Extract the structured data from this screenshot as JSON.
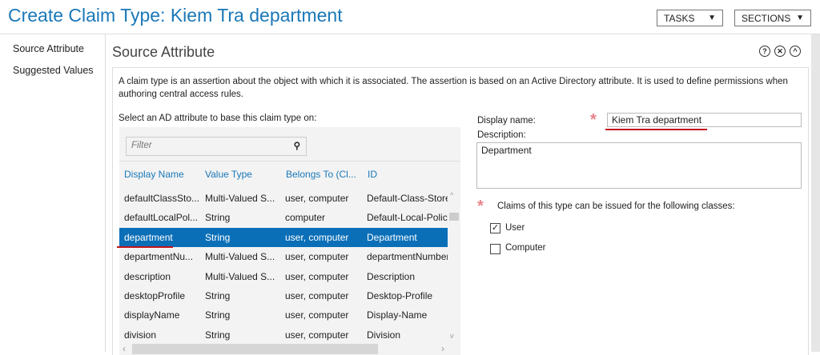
{
  "header": {
    "title": "Create Claim Type: Kiem Tra department",
    "tasks_label": "TASKS",
    "sections_label": "SECTIONS"
  },
  "nav": {
    "items": [
      {
        "label": "Source Attribute"
      },
      {
        "label": "Suggested Values"
      }
    ]
  },
  "section": {
    "title": "Source Attribute",
    "description": "A claim type is an assertion about the object with which it is associated. The assertion is based on an Active Directory attribute. It is used to define permissions when authoring central access rules.",
    "select_label": "Select an AD attribute to base this claim type on:",
    "filter_placeholder": "Filter"
  },
  "grid": {
    "columns": [
      "Display Name",
      "Value Type",
      "Belongs To (Cl...",
      "ID"
    ],
    "rows": [
      [
        "defaultClassSto...",
        "Multi-Valued S...",
        "user, computer",
        "Default-Class-Store"
      ],
      [
        "defaultLocalPol...",
        "String",
        "computer",
        "Default-Local-Policy"
      ],
      [
        "department",
        "String",
        "user, computer",
        "Department"
      ],
      [
        "departmentNu...",
        "Multi-Valued S...",
        "user, computer",
        "departmentNumber"
      ],
      [
        "description",
        "Multi-Valued S...",
        "user, computer",
        "Description"
      ],
      [
        "desktopProfile",
        "String",
        "user, computer",
        "Desktop-Profile"
      ],
      [
        "displayName",
        "String",
        "user, computer",
        "Display-Name"
      ],
      [
        "division",
        "String",
        "user, computer",
        "Division"
      ]
    ],
    "selected_index": 2
  },
  "form": {
    "display_name_label": "Display name:",
    "display_name_value": "Kiem Tra department",
    "description_label": "Description:",
    "description_value": "Department",
    "classes_label": "Claims of this type can be issued for the following classes:",
    "classes": [
      {
        "label": "User",
        "checked": true
      },
      {
        "label": "Computer",
        "checked": false
      }
    ]
  }
}
